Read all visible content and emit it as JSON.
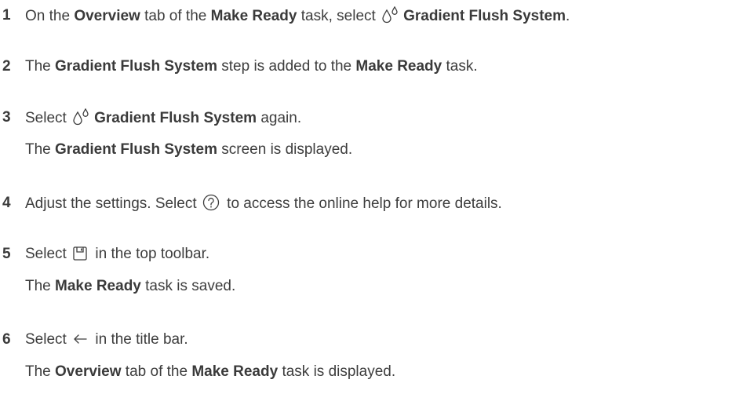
{
  "steps": [
    {
      "number": "1",
      "parts": {
        "a": "On the ",
        "b": "Overview",
        "c": " tab of the ",
        "d": "Make Ready",
        "e": " task, select ",
        "f": "Gradient Flush System",
        "g": "."
      },
      "icon": "gradient-flush-drops-icon"
    },
    {
      "number": "2",
      "parts": {
        "a": "The ",
        "b": "Gradient Flush System",
        "c": " step is added to the ",
        "d": "Make Ready",
        "e": " task."
      }
    },
    {
      "number": "3",
      "parts": {
        "a": "Select ",
        "b": "Gradient Flush System",
        "c": " again."
      },
      "icon": "gradient-flush-drops-icon",
      "result": {
        "a": "The ",
        "b": "Gradient Flush System",
        "c": " screen is displayed."
      }
    },
    {
      "number": "4",
      "parts": {
        "a": "Adjust the settings. Select ",
        "b": " to access the online help for more details."
      },
      "icon": "help-icon"
    },
    {
      "number": "5",
      "parts": {
        "a": "Select ",
        "b": " in the top toolbar."
      },
      "icon": "save-icon",
      "result": {
        "a": "The ",
        "b": "Make Ready",
        "c": " task is saved."
      }
    },
    {
      "number": "6",
      "parts": {
        "a": "Select ",
        "b": " in the title bar."
      },
      "icon": "back-arrow-icon",
      "result": {
        "a": "The ",
        "b": "Overview",
        "c": " tab of the ",
        "d": "Make Ready",
        "e": " task is displayed."
      }
    }
  ]
}
